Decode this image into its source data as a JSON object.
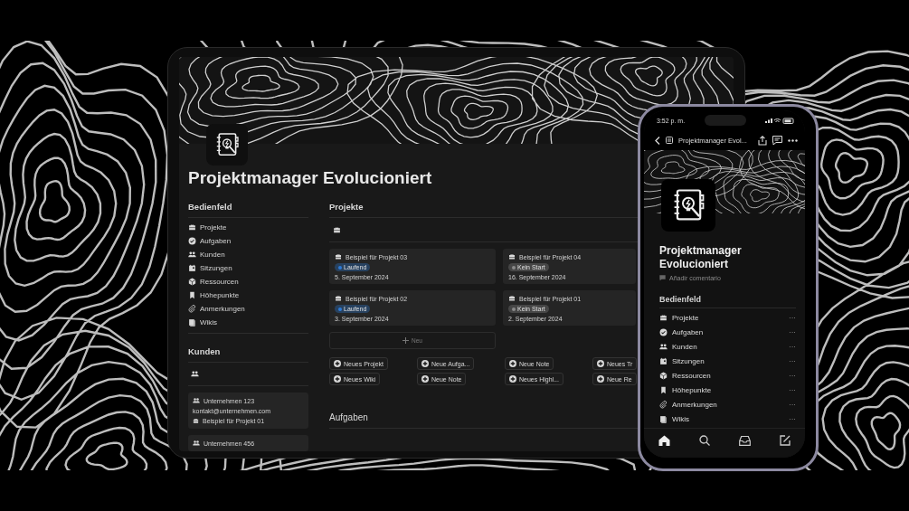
{
  "tablet": {
    "page_title": "Projektmanager Evolucioniert",
    "sidebar": {
      "heading": "Bedienfeld",
      "items": [
        {
          "label": "Projekte",
          "kind": "briefcase"
        },
        {
          "label": "Aufgaben",
          "kind": "check"
        },
        {
          "label": "Kunden",
          "kind": "people"
        },
        {
          "label": "Sitzungen",
          "kind": "calendar"
        },
        {
          "label": "Ressourcen",
          "kind": "cube"
        },
        {
          "label": "Höhepunkte",
          "kind": "bookmark"
        },
        {
          "label": "Anmerkungen",
          "kind": "clip"
        },
        {
          "label": "Wikis",
          "kind": "book"
        }
      ]
    },
    "customers": {
      "heading": "Kunden",
      "cards": [
        {
          "name": "Unternehmen 123",
          "email": "kontakt@unternehmen.com",
          "project": "Beispiel für Projekt 01"
        },
        {
          "name": "Unternehmen 456"
        }
      ]
    },
    "projects": {
      "heading": "Projekte",
      "cards": [
        {
          "title": "Beispiel für Projekt 03",
          "status": {
            "label": "Laufend",
            "color": "#2e7ad6"
          },
          "date": "5. September 2024"
        },
        {
          "title": "Beispiel für Projekt 04",
          "status": {
            "label": "Kein Start",
            "color": "#8a8a8a"
          },
          "date": "16. September 2024"
        },
        {
          "title": "Beispiel für Projekt 02",
          "status": {
            "label": "Laufend",
            "color": "#2e7ad6"
          },
          "date": "3. September 2024"
        },
        {
          "title": "Beispiel für Projekt 01",
          "status": {
            "label": "Kein Start",
            "color": "#8a8a8a"
          },
          "date": "2. September 2024"
        }
      ],
      "new_label": "Neu"
    },
    "quick_buttons": [
      "Neues Projekt",
      "Neue Aufga...",
      "Neue Note",
      "Neues Tr",
      "Neues Wiki",
      "Neue Note",
      "Neues Highl...",
      "Neue Re"
    ],
    "next_heading": "Aufgaben"
  },
  "phone": {
    "time": "3:52 p. m.",
    "nav_title": "Projektmanager Evol...",
    "page_title": "Projektmanager Evolucioniert",
    "comment": "Añadir comentario",
    "section": "Bedienfeld",
    "items": [
      {
        "label": "Projekte",
        "kind": "briefcase",
        "more": "···"
      },
      {
        "label": "Aufgaben",
        "kind": "check",
        "more": "···"
      },
      {
        "label": "Kunden",
        "kind": "people",
        "more": "···"
      },
      {
        "label": "Sitzungen",
        "kind": "calendar",
        "more": "···"
      },
      {
        "label": "Ressourcen",
        "kind": "cube",
        "more": "···"
      },
      {
        "label": "Höhepunkte",
        "kind": "bookmark",
        "more": "···"
      },
      {
        "label": "Anmerkungen",
        "kind": "clip",
        "more": "···"
      },
      {
        "label": "Wikis",
        "kind": "book",
        "more": "···"
      }
    ]
  }
}
